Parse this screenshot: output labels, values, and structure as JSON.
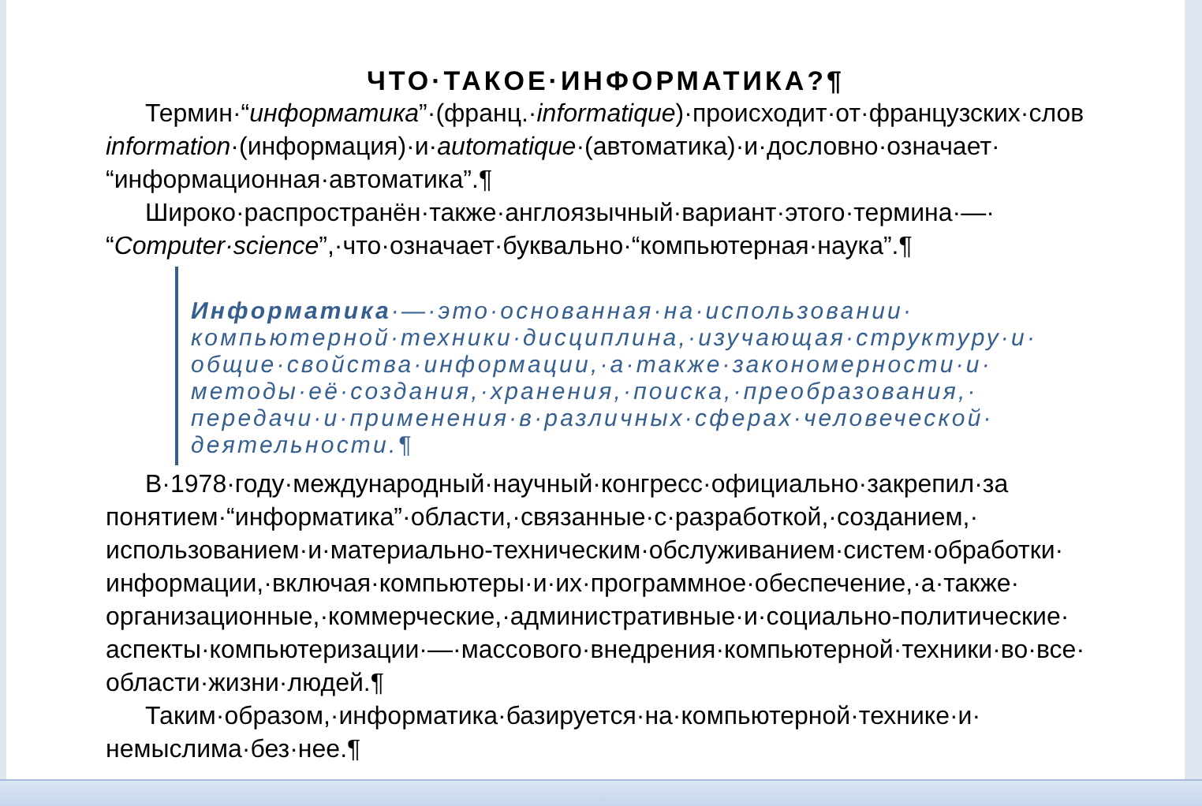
{
  "title": "ЧТО·ТАКОЕ·ИНФОРМАТИКА?¶",
  "paragraphs": [
    {
      "kind": "body",
      "lines": [
        "Термин·“*информатика*”·(франц.·*informatique*)·происходит·от·французских·слов",
        "*information*·(информация)·и·*automatique*·(автоматика)·и·дословно·означает·",
        "“информационная·автоматика”.¶"
      ]
    },
    {
      "kind": "body",
      "lines": [
        "Широко·распространён·также·англоязычный·вариант·этого·термина·—·",
        "“*Computer·science*”,·что·означает·буквально·“компьютерная·наука”.¶"
      ]
    },
    {
      "kind": "quote",
      "lines": [
        "**Информатика**·—·это·основанная·на·использовании·",
        "компьютерной·техники·дисциплина,·изучающая·структуру·и·",
        "общие·свойства·информации,·а·также·закономерности·и·",
        "методы·её·создания,·хранения,·поиска,·преобразования,·",
        "передачи·и·применения·в·различных·сферах·человеческой·",
        "деятельности.¶"
      ]
    },
    {
      "kind": "body",
      "lines": [
        "В·1978·году·международный·научный·конгресс·официально·закрепил·за",
        "понятием·“информатика”·области,·связанные·с·разработкой,·созданием,·",
        "использованием·и·материально-техническим·обслуживанием·систем·обработки·",
        "информации,·включая·компьютеры·и·их·программное·обеспечение,·а·также·",
        "организационные,·коммерческие,·административные·и·социально-политические·",
        "аспекты·компьютеризации·—·массового·внедрения·компьютерной·техники·во·все·",
        "области·жизни·людей.¶"
      ]
    },
    {
      "kind": "body",
      "lines": [
        "Таким·образом,·информатика·базируется·на·компьютерной·технике·и·",
        "немыслима·без·нее.¶"
      ]
    }
  ]
}
